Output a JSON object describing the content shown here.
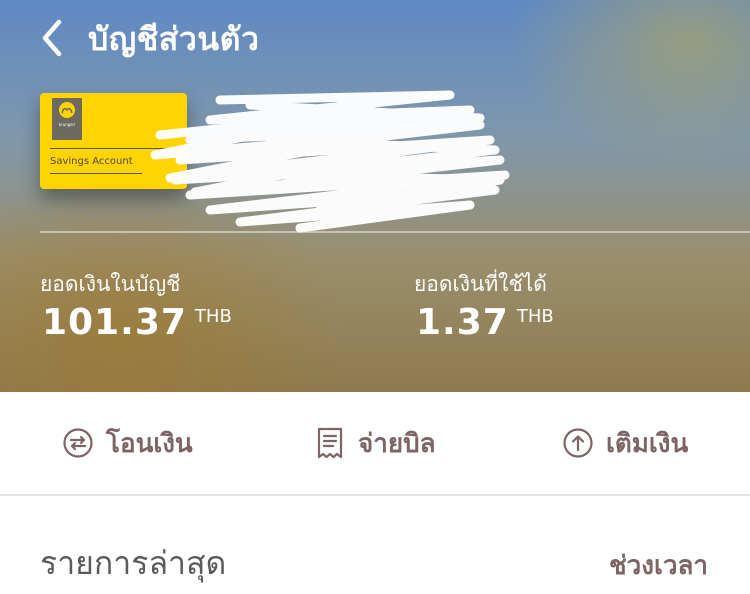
{
  "header": {
    "title": "บัญชีส่วนตัว",
    "back_icon": "chevron-left-icon"
  },
  "card": {
    "brand_text": "krungsri",
    "brand_sub": "กรุงศรี",
    "account_type": "Savings Account",
    "color": "#ffd400"
  },
  "balances": {
    "account_balance_label": "ยอดเงินในบัญชี",
    "account_balance_value": "101.37",
    "available_balance_label": "ยอดเงินที่ใช้ได้",
    "available_balance_value": "1.37",
    "currency": "THB"
  },
  "actions": [
    {
      "label": "โอนเงิน",
      "icon": "transfer-icon"
    },
    {
      "label": "จ่ายบิล",
      "icon": "receipt-icon"
    },
    {
      "label": "เติมเงิน",
      "icon": "topup-icon"
    }
  ],
  "recent": {
    "title": "รายการล่าสุด",
    "period_label": "ช่วงเวลา"
  },
  "colors": {
    "accent": "#7d6565",
    "card_yellow": "#ffd400"
  }
}
